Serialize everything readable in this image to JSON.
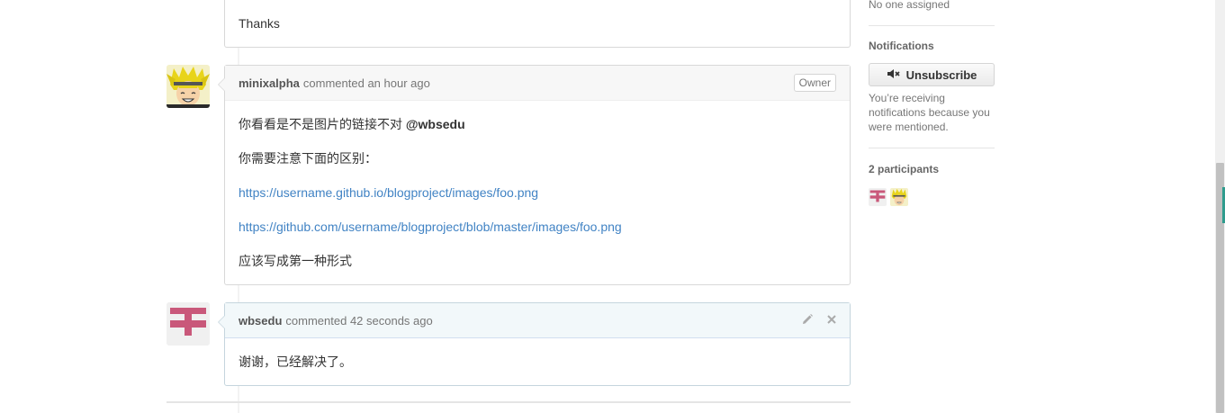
{
  "previous_comment": {
    "text": "Thanks"
  },
  "comment1": {
    "author": "minixalpha",
    "meta": "commented an hour ago",
    "badge": "Owner",
    "line1_text": "你看看是不是图片的链接不对 ",
    "line1_mention": "@wbsedu",
    "line2": "你需要注意下面的区别：",
    "link1": "https://username.github.io/blogproject/images/foo.png",
    "link2": "https://github.com/username/blogproject/blob/master/images/foo.png",
    "line5": "应该写成第一种形式"
  },
  "comment2": {
    "author": "wbsedu",
    "meta": "commented 42 seconds ago",
    "body": "谢谢，已经解决了。"
  },
  "sidebar": {
    "assignee": "No one assigned",
    "notifications_heading": "Notifications",
    "unsubscribe_label": "Unsubscribe",
    "notif_text": "You’re receiving notifications because you were mentioned.",
    "participants_heading": "2 participants"
  },
  "icons": {
    "mute": "mute-icon",
    "edit": "pencil-icon",
    "delete": "close-icon"
  },
  "colors": {
    "link": "#4183c4",
    "identicon": "#c9587a",
    "avatar_hair": "#e8d41a"
  }
}
